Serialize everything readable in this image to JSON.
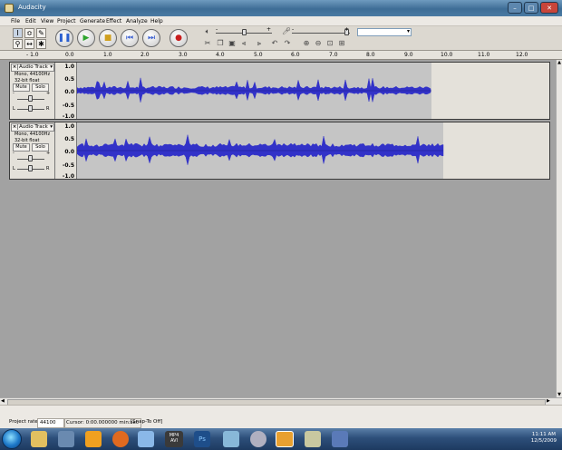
{
  "window": {
    "title": "Audacity",
    "minimize": "–",
    "maximize": "□",
    "close": "✕"
  },
  "menu": [
    "File",
    "Edit",
    "View",
    "Project",
    "Generate",
    "Effect",
    "Analyze",
    "Help"
  ],
  "toolbar": {
    "tools": [
      {
        "icon": "selection-tool-icon",
        "glyph": "I"
      },
      {
        "icon": "envelope-tool-icon",
        "glyph": "≎"
      },
      {
        "icon": "draw-tool-icon",
        "glyph": "✎"
      },
      {
        "icon": "zoom-tool-icon",
        "glyph": "⚲"
      },
      {
        "icon": "timeshift-tool-icon",
        "glyph": "↔"
      },
      {
        "icon": "multi-tool-icon",
        "glyph": "✱"
      }
    ],
    "transport": [
      {
        "icon": "pause-icon",
        "glyph": "❚❚",
        "color": "#2a5fd0"
      },
      {
        "icon": "play-icon",
        "glyph": "▶",
        "color": "#2ea52e"
      },
      {
        "icon": "stop-icon",
        "glyph": "■",
        "color": "#d0a020"
      },
      {
        "icon": "skip-start-icon",
        "glyph": "⏮",
        "color": "#3a5fd0"
      },
      {
        "icon": "skip-end-icon",
        "glyph": "⏭",
        "color": "#3a5fd0"
      },
      {
        "icon": "record-icon",
        "glyph": "●",
        "color": "#c81e1e"
      }
    ],
    "edit": [
      {
        "icon": "trim-icon",
        "glyph": "✂"
      },
      {
        "icon": "copy-icon",
        "glyph": "❐"
      },
      {
        "icon": "paste-icon",
        "glyph": "▣"
      },
      {
        "icon": "trim-outside-icon",
        "glyph": "⫷"
      },
      {
        "icon": "silence-icon",
        "glyph": "⫸"
      },
      {
        "icon": "undo-icon",
        "glyph": "↶"
      },
      {
        "icon": "redo-icon",
        "glyph": "↷"
      },
      {
        "icon": "zoom-in-icon",
        "glyph": "⊕"
      },
      {
        "icon": "zoom-out-icon",
        "glyph": "⊖"
      },
      {
        "icon": "fit-selection-icon",
        "glyph": "⊡"
      },
      {
        "icon": "fit-project-icon",
        "glyph": "⊞"
      }
    ],
    "mixer": {
      "output_volume_icon": "speaker-icon",
      "output_glyph": "🔈︎",
      "input_volume_icon": "microphone-icon",
      "input_glyph": "🎤︎",
      "minus": "-",
      "plus": "+"
    }
  },
  "ruler": {
    "ticks": [
      "- 1.0",
      "0.0",
      "1.0",
      "2.0",
      "3.0",
      "4.0",
      "5.0",
      "6.0",
      "7.0",
      "8.0",
      "9.0",
      "10.0",
      "11.0",
      "12.0"
    ]
  },
  "tracks": [
    {
      "name": "Audio Track",
      "rate": "Mono, 44100Hz",
      "format": "32-bit float",
      "mute": "Mute",
      "solo": "Solo",
      "minus": "-",
      "plus": "+",
      "left": "L",
      "right": "R",
      "scale": [
        "1.0",
        "0.5",
        "0.0",
        "-0.5",
        "-1.0"
      ],
      "wave_end_seconds": 9.4,
      "color": "#3232c8"
    },
    {
      "name": "Audio Track",
      "rate": "Mono, 44100Hz",
      "format": "32-bit float",
      "mute": "Mute",
      "solo": "Solo",
      "minus": "-",
      "plus": "+",
      "left": "L",
      "right": "R",
      "scale": [
        "1.0",
        "0.5",
        "0.0",
        "-0.5",
        "-1.0"
      ],
      "wave_end_seconds": 9.7,
      "color": "#3232c8"
    }
  ],
  "status": {
    "rate_label": "Project rate:",
    "rate_value": "44100",
    "cursor": "Cursor: 0:00.000000 min:sec",
    "snap": "[Snap-To Off]"
  },
  "taskbar": {
    "icons": [
      "explorer-icon",
      "media-icon",
      "media-player-icon",
      "firefox-icon",
      "itunes-icon",
      "mp4-avi-converter-icon",
      "photoshop-icon",
      "paint-icon",
      "search-icon",
      "audacity-icon",
      "tool-icon",
      "network-icon"
    ],
    "mp4_label": "MP4\nAVI",
    "ps_label": "Ps",
    "time": "11:11 AM",
    "date": "12/5/2009"
  },
  "colors": {
    "accent": "#3232c8",
    "track_bg": "#c5c5c5",
    "workspace": "#a2a2a2"
  }
}
